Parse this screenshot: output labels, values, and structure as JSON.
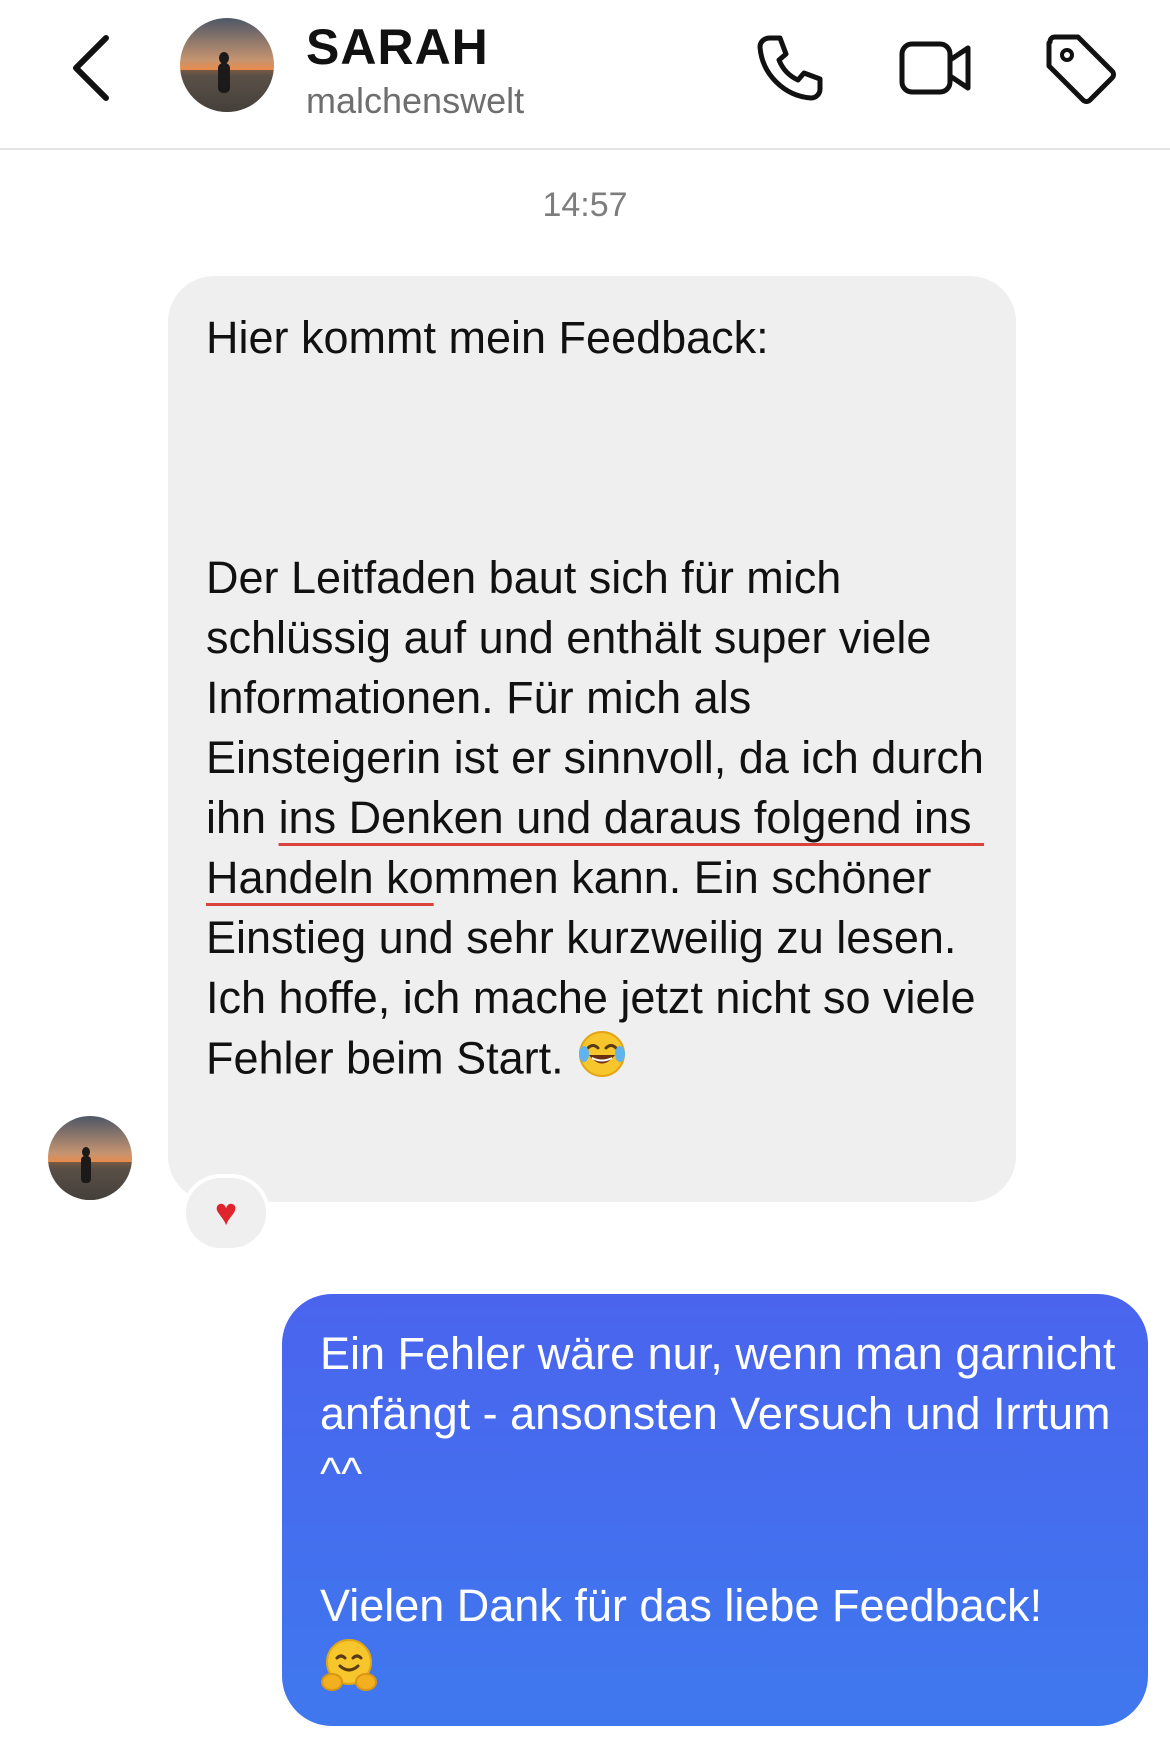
{
  "header": {
    "name": "SARAH",
    "username": "malchenswelt",
    "icons": [
      "back-chevron-icon",
      "phone-icon",
      "video-camera-icon",
      "tag-icon"
    ]
  },
  "timestamp": "14:57",
  "incoming": {
    "greeting": "Hier kommt mein Feedback:",
    "body_pre": "Der Leitfaden baut sich für mich schlüssig auf und enthält super viele Informationen. Für mich als Einsteigerin ist er sinnvoll, da ich durch ihn ",
    "body_highlight": "ins Denken und daraus folgend ins Handeln ko",
    "body_post": "mmen kann. Ein schöner Einstieg und sehr kurzweilig zu lesen. Ich hoffe, ich mache jetzt nicht so viele Fehler beim Start.",
    "emoji": "tears-of-joy-emoji",
    "reaction": "♥"
  },
  "outgoing": {
    "line1": "Ein Fehler wäre nur, wenn man garnicht anfängt - ansonsten Versuch und Irrtum ^^",
    "line2": "Vielen Dank für das liebe Feedback!",
    "emoji": "hugging-face-emoji"
  },
  "colors": {
    "incoming_bubble": "#efefef",
    "outgoing_bubble": "#4a6cee",
    "highlight_underline": "#d8443c",
    "reaction_heart": "#e0242e"
  }
}
